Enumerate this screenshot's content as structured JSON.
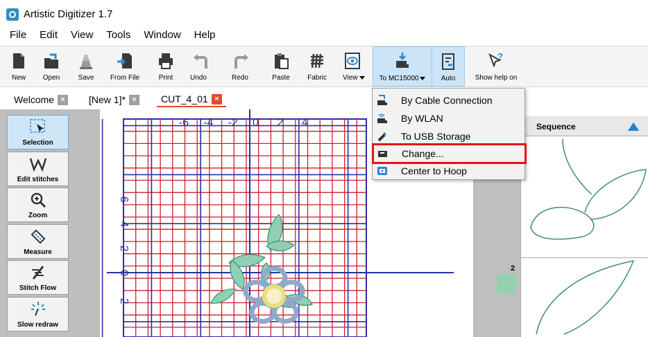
{
  "window": {
    "title": "Artistic Digitizer 1.7"
  },
  "menubar": [
    "File",
    "Edit",
    "View",
    "Tools",
    "Window",
    "Help"
  ],
  "toolbar": {
    "new": "New",
    "open": "Open",
    "save": "Save",
    "from_file": "From File",
    "print": "Print",
    "undo": "Undo",
    "redo": "Redo",
    "paste": "Paste",
    "fabric": "Fabric",
    "view": "View",
    "to_machine": "To MC15000",
    "auto": "Auto",
    "show_help": "Show help on"
  },
  "tabs": [
    {
      "label": "Welcome",
      "close": "×"
    },
    {
      "label": "[New 1]*",
      "close": "×"
    },
    {
      "label": "CUT_4_01",
      "close": "×"
    }
  ],
  "tools": [
    "Selection",
    "Edit stitches",
    "Zoom",
    "Measure",
    "Stitch Flow",
    "Slow redraw"
  ],
  "canvas": {
    "x_ticks": [
      "-6",
      "-4",
      "-2",
      "0",
      "2",
      "4"
    ],
    "y_ticks": [
      "6",
      "4",
      "2",
      "0",
      "-2"
    ]
  },
  "sequence": {
    "title": "Sequence",
    "item_number": "2"
  },
  "dropdown_menu": [
    {
      "label": "By Cable Connection",
      "icon": "cable-machine-icon"
    },
    {
      "label": "By WLAN",
      "icon": "wlan-machine-icon"
    },
    {
      "label": "To USB Storage",
      "icon": "usb-icon"
    },
    {
      "label": "Change...",
      "icon": "machine-change-icon"
    },
    {
      "label": "Center to Hoop",
      "icon": "hoop-center-icon"
    }
  ],
  "colors": {
    "grid_red": "#cc1f2a",
    "axis_blue": "#2a2fa8",
    "highlight_red": "#e3140f",
    "flower_blue": "#8fa9c9",
    "flower_center": "#e8df7a",
    "leaf_green": "#8fcfb3"
  }
}
